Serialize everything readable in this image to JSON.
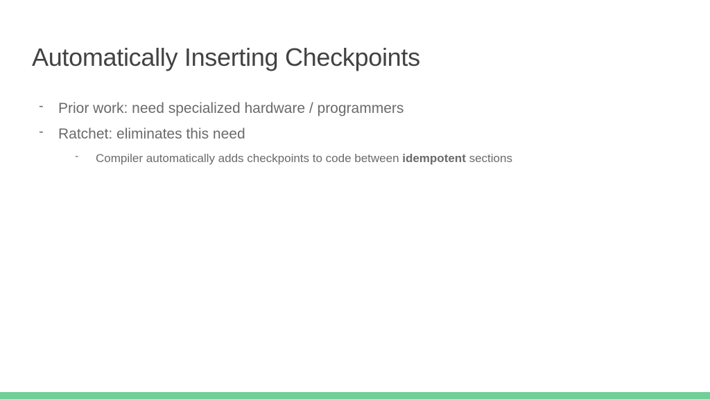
{
  "slide": {
    "title": "Automatically Inserting Checkpoints",
    "bullets": [
      {
        "text": "Prior work: need specialized hardware / programmers"
      },
      {
        "text": "Ratchet: eliminates this need",
        "sub": {
          "prefix": "Compiler automatically adds checkpoints to code between ",
          "bold": "idempotent",
          "suffix": " sections"
        }
      }
    ],
    "accent_color": "#6fcf97"
  }
}
